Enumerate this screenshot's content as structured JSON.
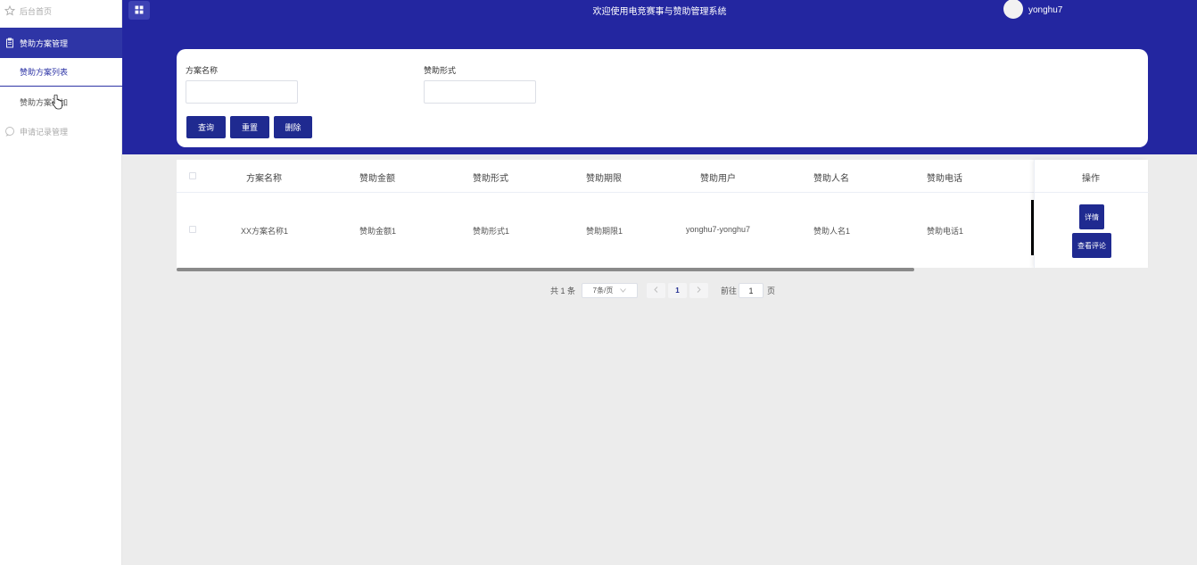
{
  "sidebar": {
    "home": "后台首页",
    "plan_group": "赞助方案管理",
    "plan_list": "赞助方案列表",
    "plan_add": "赞助方案添加",
    "apply_group": "申请记录管理"
  },
  "header": {
    "title": "欢迎使用电竞赛事与赞助管理系统",
    "username": "yonghu7"
  },
  "search": {
    "name_label": "方案名称",
    "name_value": "",
    "form_label": "赞助形式",
    "form_value": "",
    "query_btn": "查询",
    "reset_btn": "重置",
    "delete_btn": "删除"
  },
  "table": {
    "headers": [
      "方案名称",
      "赞助金额",
      "赞助形式",
      "赞助期限",
      "赞助用户",
      "赞助人名",
      "赞助电话",
      "操作"
    ],
    "rows": [
      [
        "XX方案名称1",
        "赞助金额1",
        "赞助形式1",
        "赞助期限1",
        "yonghu7-yonghu7",
        "赞助人名1",
        "赞助电话1"
      ]
    ],
    "detail_btn": "详情",
    "comment_btn": "查看评论"
  },
  "pagination": {
    "total": "共 1 条",
    "page_size": "7条/页",
    "current": "1",
    "goto_label": "前往",
    "goto_value": "1",
    "page_suffix": "页"
  },
  "colors": {
    "primary": "#2326a0",
    "button": "#1f2a90"
  }
}
